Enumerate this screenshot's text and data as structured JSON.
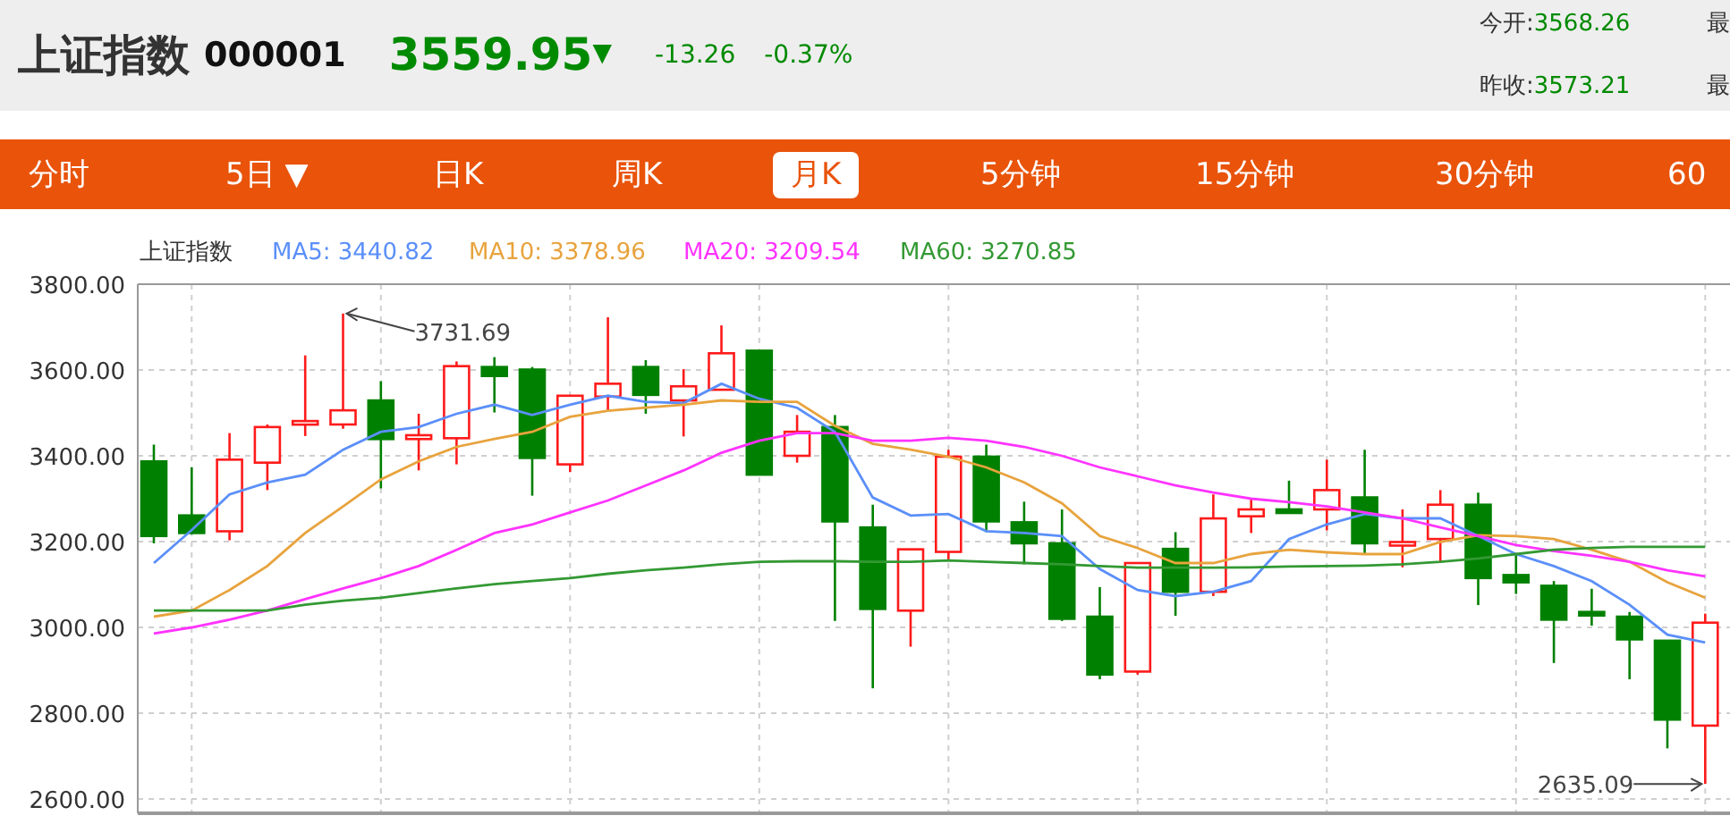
{
  "quote": {
    "name": "上证指数",
    "code": "000001",
    "price": "3559.95",
    "arrow": "▼",
    "change": "-13.26",
    "change_pct": "-0.37%",
    "stats": [
      {
        "label": "今开:",
        "value": "3568.26",
        "next": "最"
      },
      {
        "label": "昨收:",
        "value": "3573.21",
        "next": "最"
      }
    ]
  },
  "tabs": [
    {
      "label": "分时",
      "selected": false
    },
    {
      "label": "5日",
      "caret": "▼",
      "selected": false
    },
    {
      "label": "日K",
      "selected": false
    },
    {
      "label": "周K",
      "selected": false
    },
    {
      "label": "月K",
      "selected": true
    },
    {
      "label": "5分钟",
      "selected": false
    },
    {
      "label": "15分钟",
      "selected": false
    },
    {
      "label": "30分钟",
      "selected": false
    },
    {
      "label": "60",
      "selected": false
    }
  ],
  "chart": {
    "legend": [
      {
        "text": "上证指数",
        "color": "#333333"
      },
      {
        "text": "MA5: 3440.82",
        "color": "#5b8ff9"
      },
      {
        "text": "MA10: 3378.96",
        "color": "#e8a33d"
      },
      {
        "text": "MA20: 3209.54",
        "color": "#ff33ff"
      },
      {
        "text": "MA60: 3270.85",
        "color": "#339933"
      }
    ],
    "chart_data": {
      "type": "candlestick",
      "ylim": [
        2600,
        3800
      ],
      "grid": true,
      "yticks": [
        {
          "value": 3800,
          "label": "3800.00"
        },
        {
          "value": 3600,
          "label": "3600.00"
        },
        {
          "value": 3400,
          "label": "3400.00"
        },
        {
          "value": 3200,
          "label": "3200.00"
        },
        {
          "value": 3000,
          "label": "3000.00"
        },
        {
          "value": 2800,
          "label": "2800.00"
        },
        {
          "value": 2600,
          "label": "2600.00"
        }
      ],
      "ohlc": [
        [
          3387,
          3426,
          3196,
          3213
        ],
        [
          3261,
          3373,
          3217,
          3220
        ],
        [
          3224,
          3453,
          3203,
          3391
        ],
        [
          3384,
          3473,
          3320,
          3467
        ],
        [
          3473,
          3634,
          3446,
          3481
        ],
        [
          3473,
          3731.69,
          3463,
          3506
        ],
        [
          3529,
          3574,
          3324,
          3439
        ],
        [
          3439,
          3498,
          3366,
          3448
        ],
        [
          3441,
          3620,
          3380,
          3609
        ],
        [
          3607,
          3630,
          3501,
          3586
        ],
        [
          3601,
          3607,
          3307,
          3395
        ],
        [
          3380,
          3542,
          3362,
          3540
        ],
        [
          3538,
          3723,
          3505,
          3568
        ],
        [
          3607,
          3623,
          3498,
          3542
        ],
        [
          3529,
          3602,
          3445,
          3562
        ],
        [
          3554,
          3704,
          3554,
          3639
        ],
        [
          3645,
          3645,
          3356,
          3356
        ],
        [
          3400,
          3495,
          3384,
          3456
        ],
        [
          3467,
          3495,
          3015,
          3247
        ],
        [
          3233,
          3286,
          2858,
          3043
        ],
        [
          3039,
          3182,
          2955,
          3182
        ],
        [
          3176,
          3414,
          3157,
          3398
        ],
        [
          3398,
          3426,
          3222,
          3247
        ],
        [
          3245,
          3293,
          3147,
          3196
        ],
        [
          3196,
          3275,
          3015,
          3020
        ],
        [
          3025,
          3094,
          2879,
          2890
        ],
        [
          2897,
          3150,
          2890,
          3150
        ],
        [
          3183,
          3222,
          3027,
          3083
        ],
        [
          3083,
          3310,
          3073,
          3254
        ],
        [
          3259,
          3300,
          3220,
          3275
        ],
        [
          3275,
          3342,
          3268,
          3268
        ],
        [
          3275,
          3391,
          3226,
          3320
        ],
        [
          3303,
          3414,
          3171,
          3196
        ],
        [
          3192,
          3275,
          3140,
          3199
        ],
        [
          3206,
          3320,
          3150,
          3286
        ],
        [
          3286,
          3314,
          3052,
          3115
        ],
        [
          3122,
          3171,
          3078,
          3105
        ],
        [
          3097,
          3108,
          2917,
          3018
        ],
        [
          3036,
          3090,
          3004,
          3029
        ],
        [
          3025,
          3036,
          2879,
          2972
        ],
        [
          2969,
          2969,
          2718,
          2785
        ],
        [
          2771,
          3032,
          2635.09,
          3011
        ]
      ],
      "series": [
        {
          "type": "line",
          "color": "#5b8ff9",
          "values": [
            3150,
            3227,
            3310,
            3338,
            3356,
            3414,
            3456,
            3467,
            3498,
            3519,
            3495,
            3519,
            3540,
            3526,
            3523,
            3568,
            3533,
            3512,
            3456,
            3303,
            3261,
            3264,
            3224,
            3220,
            3213,
            3136,
            3087,
            3073,
            3083,
            3108,
            3206,
            3240,
            3264,
            3254,
            3254,
            3213,
            3171,
            3143,
            3108,
            3053,
            2983,
            2965
          ]
        },
        {
          "type": "line",
          "color": "#e8a33d",
          "values": [
            3025,
            3039,
            3087,
            3143,
            3220,
            3282,
            3345,
            3387,
            3421,
            3439,
            3456,
            3491,
            3505,
            3512,
            3519,
            3529,
            3526,
            3526,
            3470,
            3428,
            3414,
            3398,
            3373,
            3338,
            3289,
            3213,
            3185,
            3150,
            3150,
            3171,
            3181,
            3175,
            3171,
            3171,
            3199,
            3215,
            3213,
            3206,
            3181,
            3153,
            3105,
            3069
          ]
        },
        {
          "type": "line",
          "color": "#ff33ff",
          "values": [
            2986,
            3000,
            3018,
            3039,
            3066,
            3091,
            3115,
            3143,
            3181,
            3220,
            3240,
            3268,
            3296,
            3331,
            3366,
            3407,
            3435,
            3453,
            3453,
            3435,
            3435,
            3442,
            3435,
            3421,
            3400,
            3373,
            3352,
            3331,
            3314,
            3300,
            3292,
            3282,
            3268,
            3254,
            3233,
            3213,
            3192,
            3178,
            3167,
            3153,
            3133,
            3119
          ]
        },
        {
          "type": "line",
          "color": "#339933",
          "values": [
            3039,
            3039,
            3039,
            3039,
            3053,
            3062,
            3069,
            3080,
            3091,
            3101,
            3108,
            3115,
            3125,
            3133,
            3139,
            3147,
            3153,
            3154,
            3154,
            3153,
            3153,
            3156,
            3153,
            3150,
            3147,
            3143,
            3139,
            3139,
            3139,
            3140,
            3142,
            3143,
            3144,
            3147,
            3153,
            3161,
            3171,
            3181,
            3185,
            3188,
            3188,
            3188
          ]
        }
      ],
      "annotations": [
        {
          "text": "3731.69"
        },
        {
          "text": "2635.09"
        }
      ]
    }
  }
}
